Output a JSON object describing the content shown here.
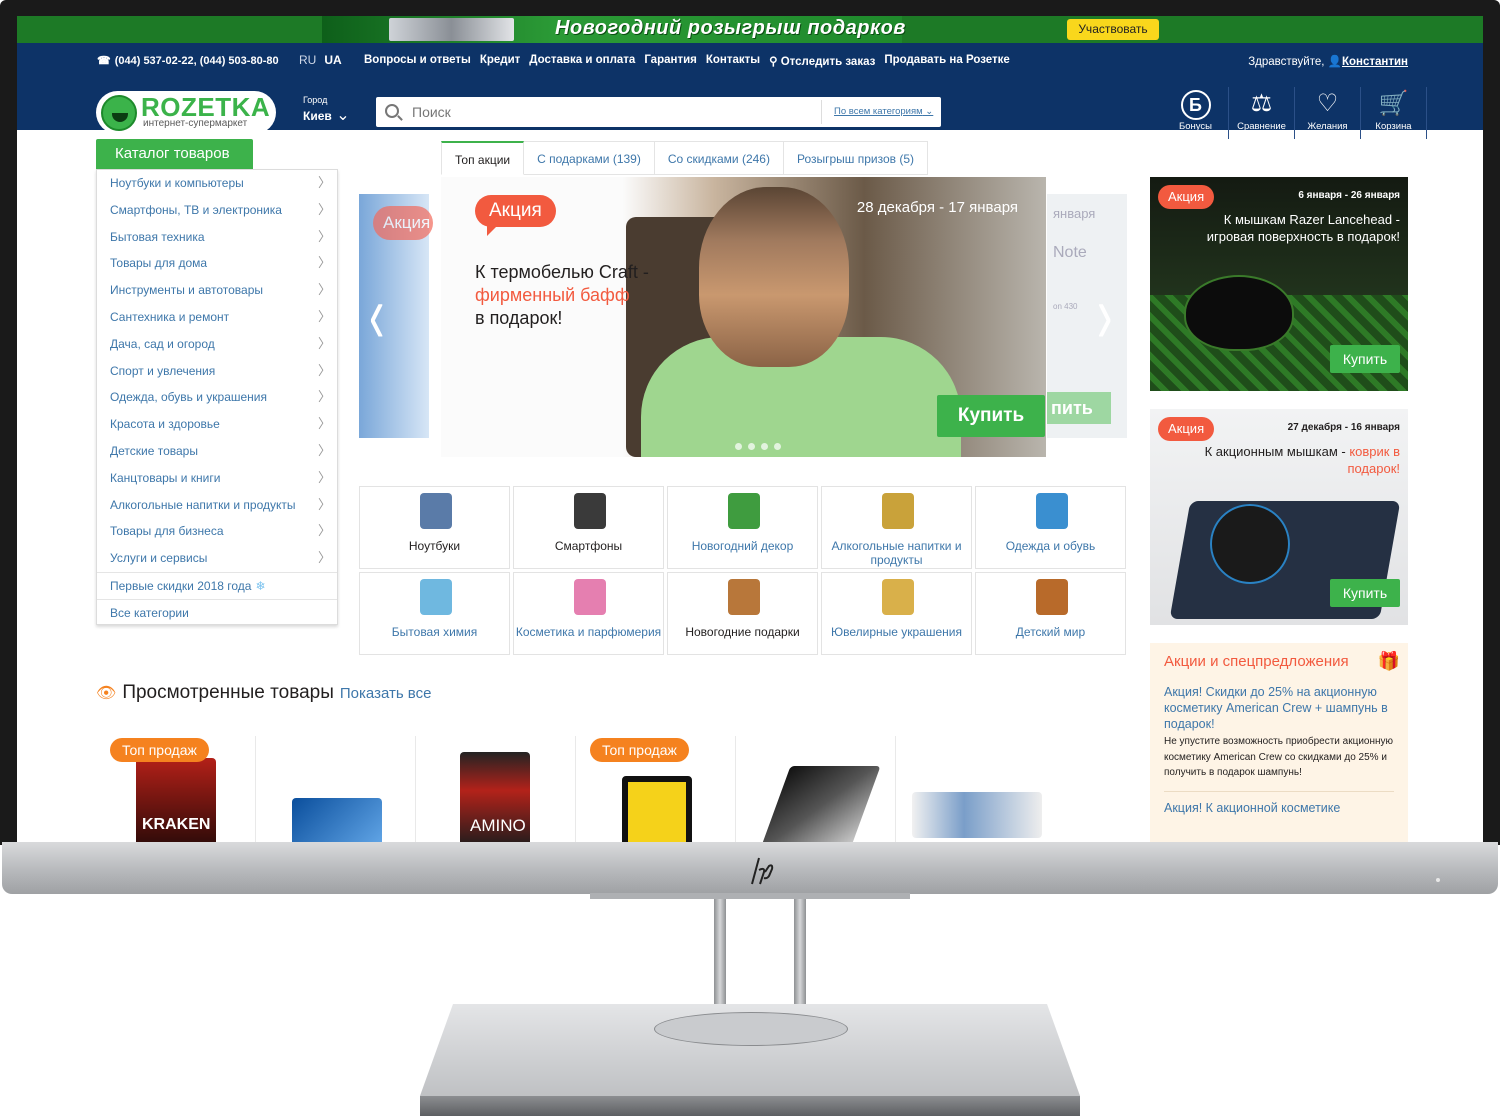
{
  "promo_banner": {
    "text": "Новогодний розыгрыш подарков",
    "button": "Участвовать"
  },
  "header": {
    "phone": "(044) 537-02-22, (044) 503-80-80",
    "lang": [
      "RU",
      "UA"
    ],
    "nav": [
      "Вопросы и ответы",
      "Кредит",
      "Доставка и оплата",
      "Гарантия",
      "Контакты",
      "Отследить заказ",
      "Продавать на Розетке"
    ],
    "greeting": "Здравствуйте,",
    "user": "Константин",
    "logo_name": "ROZETKA",
    "logo_tagline": "интернет-супермаркет",
    "city_label": "Город",
    "city": "Киев",
    "search_placeholder": "Поиск",
    "search_category": "По всем категориям",
    "icons": [
      {
        "label": "Бонусы",
        "icon": "bonus-icon",
        "glyph": "Б"
      },
      {
        "label": "Сравнение",
        "icon": "scales-icon",
        "glyph": "⚖"
      },
      {
        "label": "Желания",
        "icon": "heart-icon",
        "glyph": "♡"
      },
      {
        "label": "Корзина",
        "icon": "cart-icon",
        "glyph": "🛒"
      }
    ]
  },
  "catalog": {
    "button": "Каталог товаров",
    "items": [
      "Ноутбуки и компьютеры",
      "Смартфоны, ТВ и электроника",
      "Бытовая техника",
      "Товары для дома",
      "Инструменты и автотовары",
      "Сантехника и ремонт",
      "Дача, сад и огород",
      "Спорт и увлечения",
      "Одежда, обувь и украшения",
      "Красота и здоровье",
      "Детские товары",
      "Канцтовары и книги",
      "Алкогольные напитки и продукты",
      "Товары для бизнеса",
      "Услуги и сервисы"
    ],
    "extra1": "Первые скидки 2018 года",
    "extra2": "Все категории"
  },
  "tabs": [
    "Топ акции",
    "С подарками (139)",
    "Со скидками (246)",
    "Розыгрыш призов (5)"
  ],
  "slider": {
    "tag": "Акция",
    "date": "28 декабря - 17 января",
    "text1": "К термобелью Craft -",
    "text_red": "фирменный бафф",
    "text2": "в подарок!",
    "buy": "Купить",
    "prev_tag": "Акция",
    "next_date": "января",
    "next_text": "Note",
    "next_mini": "on 430",
    "next_buy": "пить"
  },
  "categories": [
    {
      "label": "Ноутбуки",
      "color": "#5a7ba8"
    },
    {
      "label": "Смартфоны",
      "color": "#3a3a3a"
    },
    {
      "label": "Новогодний декор",
      "color": "#3f9c3f"
    },
    {
      "label": "Алкогольные напитки и продукты",
      "color": "#c9a23a"
    },
    {
      "label": "Одежда и обувь",
      "color": "#3a8fd0"
    },
    {
      "label": "Бытовая химия",
      "color": "#6fb8e0"
    },
    {
      "label": "Косметика и парфюмерия",
      "color": "#e57fb0"
    },
    {
      "label": "Новогодние подарки",
      "color": "#b8773a"
    },
    {
      "label": "Ювелирные украшения",
      "color": "#d9b04a"
    },
    {
      "label": "Детский мир",
      "color": "#b86a2a"
    }
  ],
  "viewed": {
    "title": "Просмотренные товары",
    "show_all": "Показать все",
    "top_label": "Топ продаж",
    "kraken_label": "KRAKEN",
    "amino_label": "AMINO"
  },
  "ads": [
    {
      "tag": "Акция",
      "date": "6 января - 26 января",
      "text": "К мышкам Razer Lancehead - игровая поверхность в подарок!",
      "buy": "Купить"
    },
    {
      "tag": "Акция",
      "date": "27 декабря - 16 января",
      "text": "К акционным мышкам -",
      "text_red": "коврик в подарок!",
      "buy": "Купить"
    }
  ],
  "offers": {
    "title": "Акции и спецпредложения",
    "o1_link": "Акция! Скидки до 25% на акционную косметику American Crew + шампунь в подарок!",
    "o1_desc": "Не упустите возможность приобрести акционную косметику American Crew со скидками до 25% и получить в подарок шампунь!",
    "o2_link": "Акция! К акционной косметике"
  },
  "monitor": {
    "brand": "hp"
  }
}
